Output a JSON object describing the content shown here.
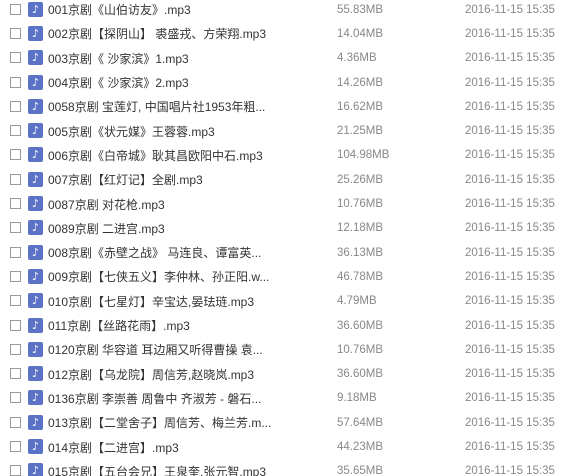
{
  "icon": "music-file-icon",
  "icon_glyph": "♪",
  "files": [
    {
      "name": "001京剧《山伯访友》.mp3",
      "size": "55.83MB",
      "modified": "2016-11-15 15:35"
    },
    {
      "name": "002京剧【探阴山】 裘盛戎、方荣翔.mp3",
      "size": "14.04MB",
      "modified": "2016-11-15 15:35"
    },
    {
      "name": "003京剧《 沙家滨》1.mp3",
      "size": "4.36MB",
      "modified": "2016-11-15 15:35"
    },
    {
      "name": "004京剧《 沙家滨》2.mp3",
      "size": "14.26MB",
      "modified": "2016-11-15 15:35"
    },
    {
      "name": "0058京剧 宝莲灯, 中国唱片社1953年粗...",
      "size": "16.62MB",
      "modified": "2016-11-15 15:35"
    },
    {
      "name": "005京剧《状元媒》王蓉蓉.mp3",
      "size": "21.25MB",
      "modified": "2016-11-15 15:35"
    },
    {
      "name": "006京剧《白帝城》耿其昌欧阳中石.mp3",
      "size": "104.98MB",
      "modified": "2016-11-15 15:35"
    },
    {
      "name": "007京剧【红灯记】全剧.mp3",
      "size": "25.26MB",
      "modified": "2016-11-15 15:35"
    },
    {
      "name": "0087京剧 对花枪.mp3",
      "size": "10.76MB",
      "modified": "2016-11-15 15:35"
    },
    {
      "name": "0089京剧 二进宫.mp3",
      "size": "12.18MB",
      "modified": "2016-11-15 15:35"
    },
    {
      "name": "008京剧《赤壁之战》 马连良、谭富英...",
      "size": "36.13MB",
      "modified": "2016-11-15 15:35"
    },
    {
      "name": "009京剧【七侠五义】李仲林、孙正阳.w...",
      "size": "46.78MB",
      "modified": "2016-11-15 15:35"
    },
    {
      "name": "010京剧【七星灯】辛宝达,晏珐琏.mp3",
      "size": "4.79MB",
      "modified": "2016-11-15 15:35"
    },
    {
      "name": "011京剧【丝路花雨】.mp3",
      "size": "36.60MB",
      "modified": "2016-11-15 15:35"
    },
    {
      "name": "0120京剧 华容道 耳边厢又听得曹操 袁...",
      "size": "10.76MB",
      "modified": "2016-11-15 15:35"
    },
    {
      "name": "012京剧【乌龙院】周信芳,赵晓岚.mp3",
      "size": "36.60MB",
      "modified": "2016-11-15 15:35"
    },
    {
      "name": "0136京剧 李崇善 周鲁中 齐淑芳 - 磐石...",
      "size": "9.18MB",
      "modified": "2016-11-15 15:35"
    },
    {
      "name": "013京剧【二堂舍子】周信芳、梅兰芳.m...",
      "size": "57.64MB",
      "modified": "2016-11-15 15:35"
    },
    {
      "name": "014京剧【二进宫】.mp3",
      "size": "44.23MB",
      "modified": "2016-11-15 15:35"
    },
    {
      "name": "015京剧【五台会兄】王泉奎,张元智.mp3",
      "size": "35.65MB",
      "modified": "2016-11-15 15:35"
    }
  ]
}
